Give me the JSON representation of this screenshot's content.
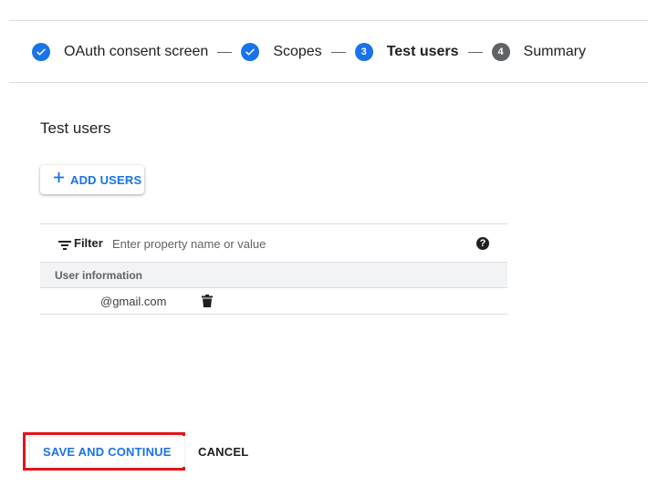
{
  "stepper": {
    "steps": [
      {
        "label": "OAuth consent screen",
        "state": "done",
        "marker": ""
      },
      {
        "label": "Scopes",
        "state": "done",
        "marker": ""
      },
      {
        "label": "Test users",
        "state": "active",
        "marker": "3"
      },
      {
        "label": "Summary",
        "state": "todo",
        "marker": "4"
      }
    ]
  },
  "section": {
    "title": "Test users"
  },
  "add_users": {
    "label": "ADD USERS",
    "icon": "plus-icon"
  },
  "table": {
    "filter_label": "Filter",
    "filter_placeholder": "Enter property name or value",
    "help_icon": "help-icon",
    "column_header": "User information",
    "rows": [
      {
        "email": "@gmail.com",
        "action_icon": "delete-icon"
      }
    ]
  },
  "footer": {
    "save_label": "SAVE AND CONTINUE",
    "cancel_label": "CANCEL"
  },
  "colors": {
    "accent": "#1a73e8",
    "highlight_border": "#e3141c",
    "todo_step": "#5f6368"
  }
}
